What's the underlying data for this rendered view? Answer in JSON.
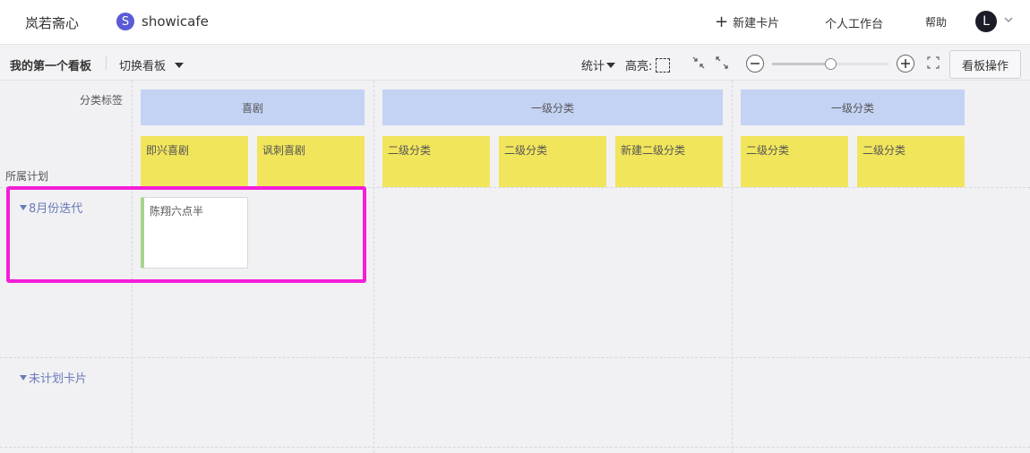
{
  "topbar": {
    "brand": "岚若斋心",
    "team_logo_letter": "S",
    "team_name": "showicafe",
    "new_card": "新建卡片",
    "workspace": "个人工作台",
    "help": "帮助",
    "avatar_letter": "L"
  },
  "toolbar": {
    "board_name": "我的第一个看板",
    "switch_board": "切换看板",
    "stats": "统计",
    "highlight": "高亮:",
    "zoom_level": 0.5,
    "board_ops": "看板操作"
  },
  "board": {
    "category_header": "分类标签",
    "plan_header": "所属计划",
    "level1": [
      {
        "label": "喜剧"
      },
      {
        "label": "一级分类"
      },
      {
        "label": "一级分类"
      }
    ],
    "level2": [
      {
        "label": "即兴喜剧"
      },
      {
        "label": "讽刺喜剧"
      },
      {
        "label": "二级分类"
      },
      {
        "label": "二级分类"
      },
      {
        "label": "新建二级分类"
      },
      {
        "label": "二级分类"
      },
      {
        "label": "二级分类"
      }
    ],
    "iteration": "8月份迭代",
    "unplanned": "未计划卡片",
    "card": {
      "title": "陈翔六点半"
    }
  },
  "colors": {
    "level1_bg": "#c4d2f4",
    "level2_bg": "#f1e55c",
    "highlight_border": "#f41ed8",
    "link_blue": "#6b7ab8",
    "card_accent": "#a8d48c"
  }
}
